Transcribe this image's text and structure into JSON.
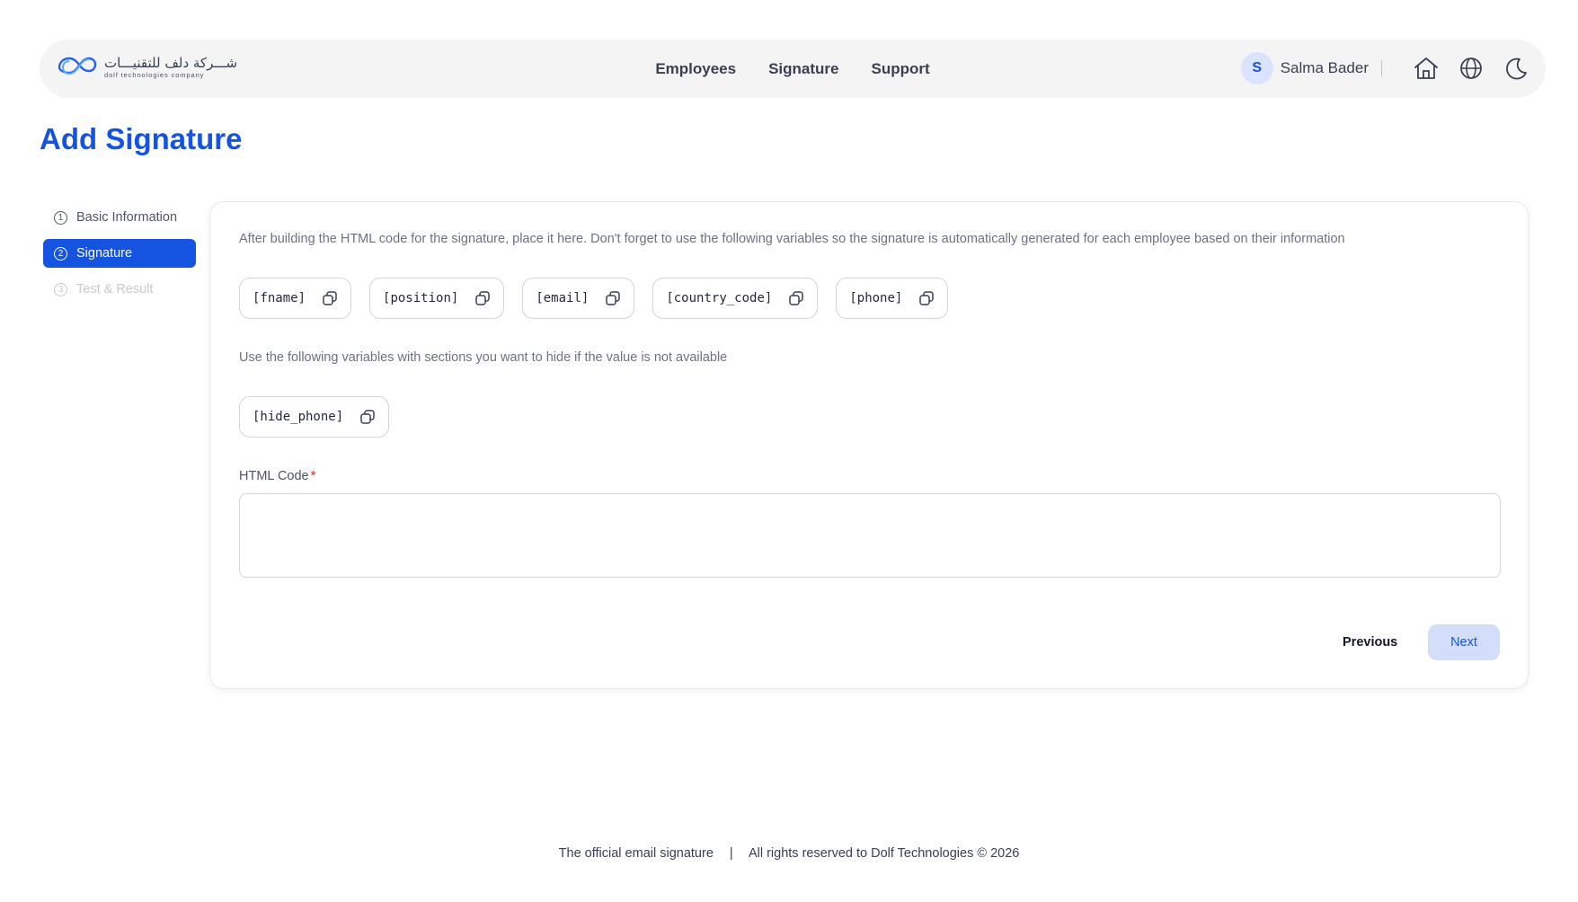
{
  "brand": {
    "name_ar": "شـــركة دلف للتقنيـــات",
    "name_en": "Dolf technologies company",
    "accent_color": "#1454e0"
  },
  "nav": {
    "items": [
      {
        "label": "Employees"
      },
      {
        "label": "Signature"
      },
      {
        "label": "Support"
      }
    ]
  },
  "user": {
    "initial": "S",
    "name": "Salma Bader",
    "icons": [
      "home-icon",
      "globe-icon",
      "moon-icon"
    ]
  },
  "page": {
    "title": "Add Signature"
  },
  "steps": [
    {
      "num": "1",
      "label": "Basic Information",
      "state": "done"
    },
    {
      "num": "2",
      "label": "Signature",
      "state": "active"
    },
    {
      "num": "3",
      "label": "Test & Result",
      "state": "disabled"
    }
  ],
  "form": {
    "intro": "After building the HTML code for the signature, place it here. Don't forget to use the following variables so the signature is automatically generated for each employee based on their information",
    "variables": [
      "[fname]",
      "[position]",
      "[email]",
      "[country_code]",
      "[phone]"
    ],
    "hide_hint": "Use the following variables with sections you want to hide if the value is not available",
    "hide_variables": [
      "[hide_phone]"
    ],
    "html_code_label": "HTML Code",
    "required_mark": "*",
    "html_code_value": "",
    "previous_label": "Previous",
    "next_label": "Next"
  },
  "footer": {
    "left": "The official email signature",
    "separator": "|",
    "right": "All rights reserved to Dolf Technologies © 2026"
  }
}
